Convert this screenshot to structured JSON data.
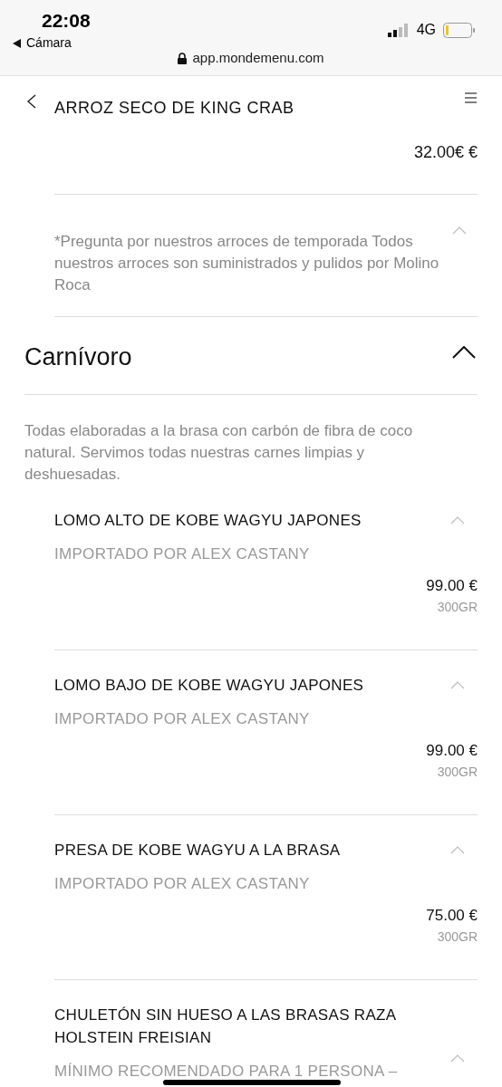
{
  "status_bar": {
    "time": "22:08",
    "back_app": "Cámara",
    "network": "4G",
    "url": "app.mondemenu.com"
  },
  "top_item": {
    "name": "ARROZ SECO DE KING CRAB",
    "price": "32.00€ €"
  },
  "note": {
    "text": "*Pregunta por nuestros arroces de temporada Todos nuestros arroces son suministrados y pulidos por Molino Roca",
    "expanded": true
  },
  "section": {
    "title": "Carnívoro",
    "expanded": true,
    "description": "Todas elaboradas a la brasa con carbón de fibra de coco natural. Servimos todas nuestras carnes limpias y deshuesadas.",
    "items": [
      {
        "name": "LOMO ALTO DE KOBE WAGYU JAPONES",
        "subtitle": "IMPORTADO POR ALEX CASTANY",
        "price": "99.00 €",
        "weight": "300GR",
        "expanded": true
      },
      {
        "name": "LOMO BAJO DE KOBE WAGYU JAPONES",
        "subtitle": "IMPORTADO POR ALEX CASTANY",
        "price": "99.00 €",
        "weight": "300GR",
        "expanded": true
      },
      {
        "name": "PRESA DE KOBE WAGYU A LA BRASA",
        "subtitle": "IMPORTADO POR ALEX CASTANY",
        "price": "75.00 €",
        "weight": "300GR",
        "expanded": true
      },
      {
        "name": "CHULETÓN SIN HUESO A LAS BRASAS RAZA HOLSTEIN FREISIAN",
        "subtitle": "MÍNIMO RECOMENDADO PARA 1 PERSONA –",
        "expanded": true
      }
    ]
  }
}
